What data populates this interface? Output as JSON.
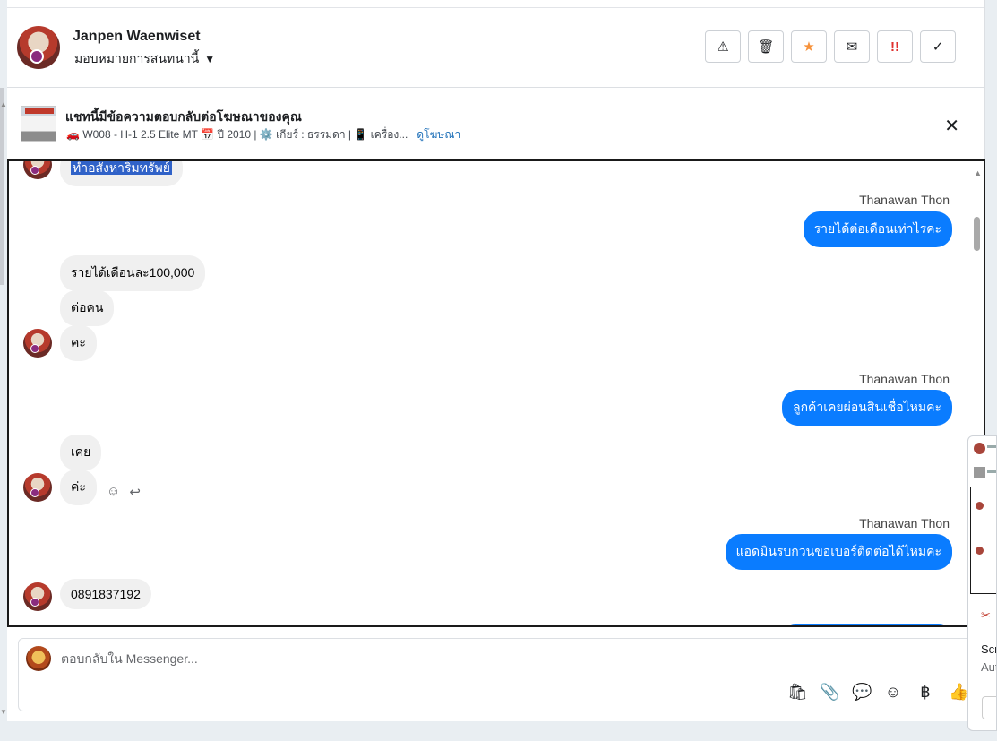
{
  "header": {
    "user_name": "Janpen Waenwiset",
    "assign_label": "มอบหมายการสนทนานี้",
    "actions": [
      {
        "icon": "warning-icon",
        "glyph": "⚠"
      },
      {
        "icon": "trash-icon",
        "glyph": "🗑"
      },
      {
        "icon": "star-icon",
        "glyph": "★"
      },
      {
        "icon": "envelope-icon",
        "glyph": "✉"
      },
      {
        "icon": "urgent-icon",
        "glyph": "!!"
      },
      {
        "icon": "check-icon",
        "glyph": "✓"
      }
    ]
  },
  "ad": {
    "title": "แชทนี้มีข้อความตอบกลับต่อโฆษณาของคุณ",
    "subtitle": "🚗 W008 - H-1 2.5 Elite MT 📅 ปี 2010 | ⚙️ เกียร์ : ธรรมดา | 📱 เครื่อง...",
    "link": "ดูโฆษณา",
    "close_glyph": "✕"
  },
  "messages": [
    {
      "dir": "in",
      "text": "ทำอสังหาริมทรัพย์",
      "highlight": true
    },
    {
      "dir": "out",
      "sender": "Thanawan Thon",
      "text": "รายได้ต่อเดือนเท่าไรคะ"
    },
    {
      "dir": "in",
      "text": "รายได้เดือนละ100,000"
    },
    {
      "dir": "in",
      "text": "ต่อคน"
    },
    {
      "dir": "in",
      "text": "คะ"
    },
    {
      "dir": "out",
      "sender": "Thanawan Thon",
      "text": "ลูกค้าเคยผ่อนสินเชื่อไหมคะ"
    },
    {
      "dir": "in",
      "text": "เคย"
    },
    {
      "dir": "in",
      "text": "ค่ะ"
    },
    {
      "dir": "out",
      "sender": "Thanawan Thon",
      "text": "แอดมินรบกวนขอเบอร์ติดต่อได้ไหมคะ"
    },
    {
      "dir": "in",
      "text": "0891837192"
    }
  ],
  "message_tools": {
    "react_glyph": "☺",
    "reply_glyph": "↩"
  },
  "composer": {
    "placeholder": "ตอบกลับใน Messenger...",
    "tools": [
      {
        "icon": "shopping-bag-icon",
        "glyph": "🛍"
      },
      {
        "icon": "attachment-icon",
        "glyph": "📎"
      },
      {
        "icon": "saved-reply-icon",
        "glyph": "💬"
      },
      {
        "icon": "emoji-icon",
        "glyph": "☺"
      },
      {
        "icon": "payment-baht-icon",
        "glyph": "฿"
      },
      {
        "icon": "thumbs-up-icon",
        "glyph": "👍"
      }
    ]
  },
  "side_panel": {
    "text_1": "Scr",
    "text_2": "Aut"
  },
  "colors": {
    "accent": "#0a7cff",
    "incoming_bubble": "#f0f0f0",
    "highlight": "#3062c8",
    "link": "#1d6fb8"
  }
}
